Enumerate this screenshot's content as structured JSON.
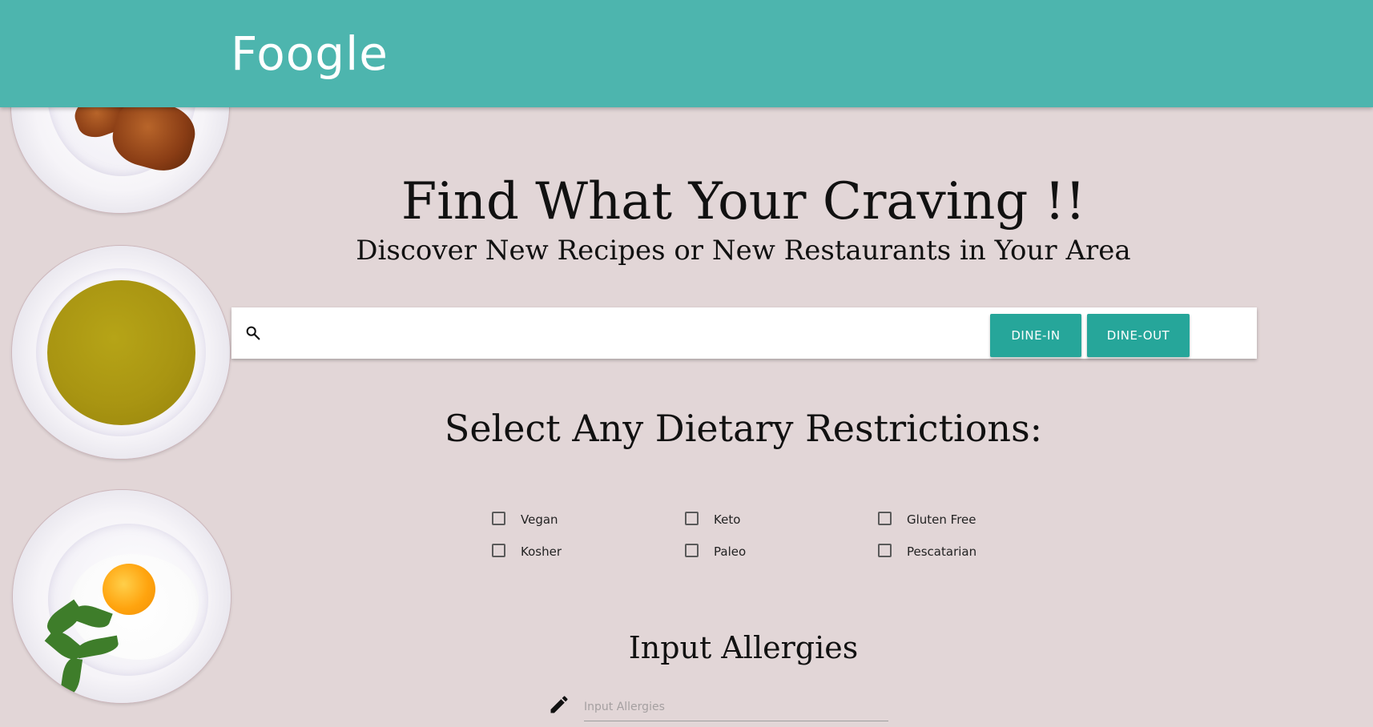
{
  "header": {
    "brand": "Foogle",
    "color": "#4db5ae"
  },
  "hero": {
    "title": "Find What Your Craving !!",
    "subtitle": "Discover New Recipes or New Restaurants in Your Area"
  },
  "search": {
    "icon": "search-icon",
    "value": "",
    "placeholder": "",
    "buttons": {
      "dine_in": "DINE-IN",
      "dine_out": "DINE-OUT"
    },
    "button_color": "#26a69a"
  },
  "diet": {
    "title": "Select Any Dietary Restrictions:",
    "options": [
      {
        "label": "Vegan",
        "checked": false
      },
      {
        "label": "Keto",
        "checked": false
      },
      {
        "label": "Gluten Free",
        "checked": false
      },
      {
        "label": "Kosher",
        "checked": false
      },
      {
        "label": "Paleo",
        "checked": false
      },
      {
        "label": "Pescatarian",
        "checked": false
      }
    ]
  },
  "allergies": {
    "title": "Input Allergies",
    "icon": "pencil-icon",
    "placeholder": "Input Allergies",
    "value": ""
  },
  "sidebar_images": [
    {
      "name": "croissant-plate-image"
    },
    {
      "name": "soup-plate-image"
    },
    {
      "name": "egg-plate-image"
    }
  ]
}
